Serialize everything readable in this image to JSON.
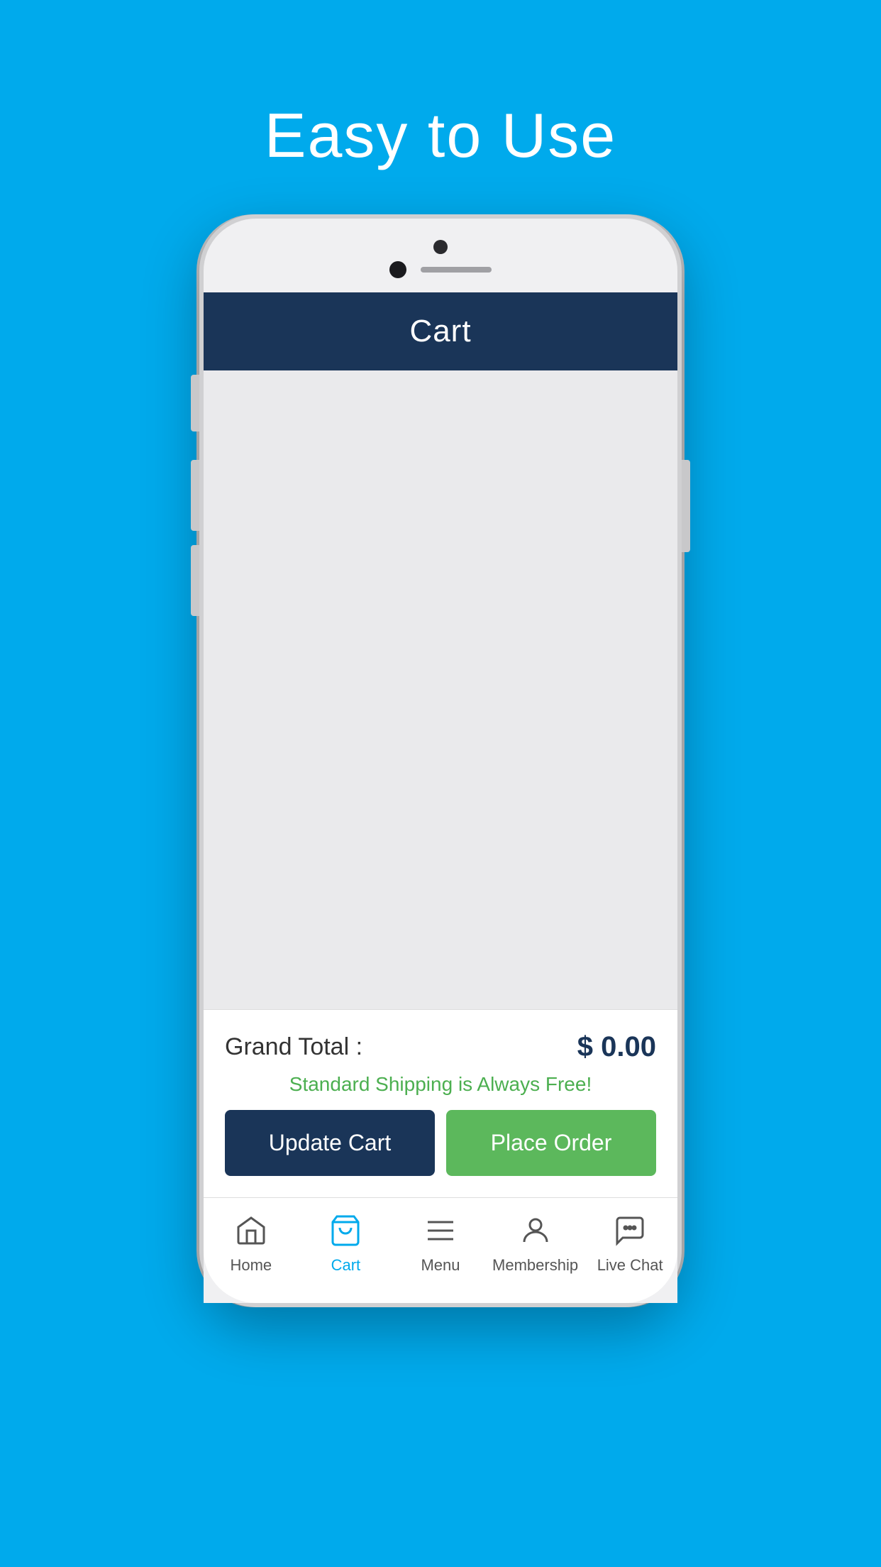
{
  "page": {
    "title": "Easy to Use",
    "background_color": "#00AAEC"
  },
  "app": {
    "header": {
      "title": "Cart"
    },
    "grand_total": {
      "label": "Grand Total :",
      "value": "$ 0.00"
    },
    "shipping_notice": "Standard Shipping is Always Free!",
    "buttons": {
      "update_cart": "Update Cart",
      "place_order": "Place Order"
    },
    "bottom_nav": {
      "items": [
        {
          "id": "home",
          "label": "Home",
          "active": false
        },
        {
          "id": "cart",
          "label": "Cart",
          "active": true
        },
        {
          "id": "menu",
          "label": "Menu",
          "active": false
        },
        {
          "id": "membership",
          "label": "Membership",
          "active": false
        },
        {
          "id": "live-chat",
          "label": "Live Chat",
          "active": false
        }
      ]
    }
  }
}
